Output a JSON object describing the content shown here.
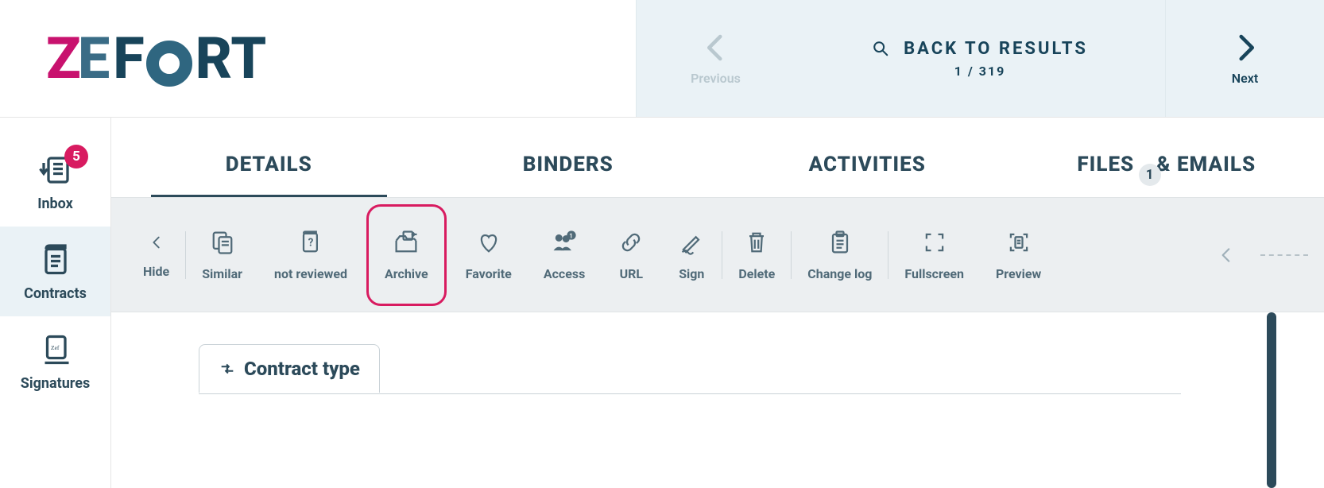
{
  "logo": {
    "text": "ZEFORT"
  },
  "header_nav": {
    "previous": "Previous",
    "next": "Next",
    "back_label": "BACK TO RESULTS",
    "position": "1 / 319"
  },
  "sidebar": {
    "items": [
      {
        "label": "Inbox",
        "badge": "5"
      },
      {
        "label": "Contracts"
      },
      {
        "label": "Signatures"
      }
    ]
  },
  "tabs": {
    "details": "DETAILS",
    "binders": "BINDERS",
    "activities": "ACTIVITIES",
    "files": "FILES",
    "files_badge": "1",
    "emails": "& EMAILS"
  },
  "toolbar": {
    "hide": "Hide",
    "similar": "Similar",
    "not_reviewed": "not reviewed",
    "archive": "Archive",
    "favorite": "Favorite",
    "access": "Access",
    "url": "URL",
    "sign": "Sign",
    "delete": "Delete",
    "change_log": "Change log",
    "fullscreen": "Fullscreen",
    "preview": "Preview"
  },
  "section": {
    "contract_type": "Contract type"
  }
}
